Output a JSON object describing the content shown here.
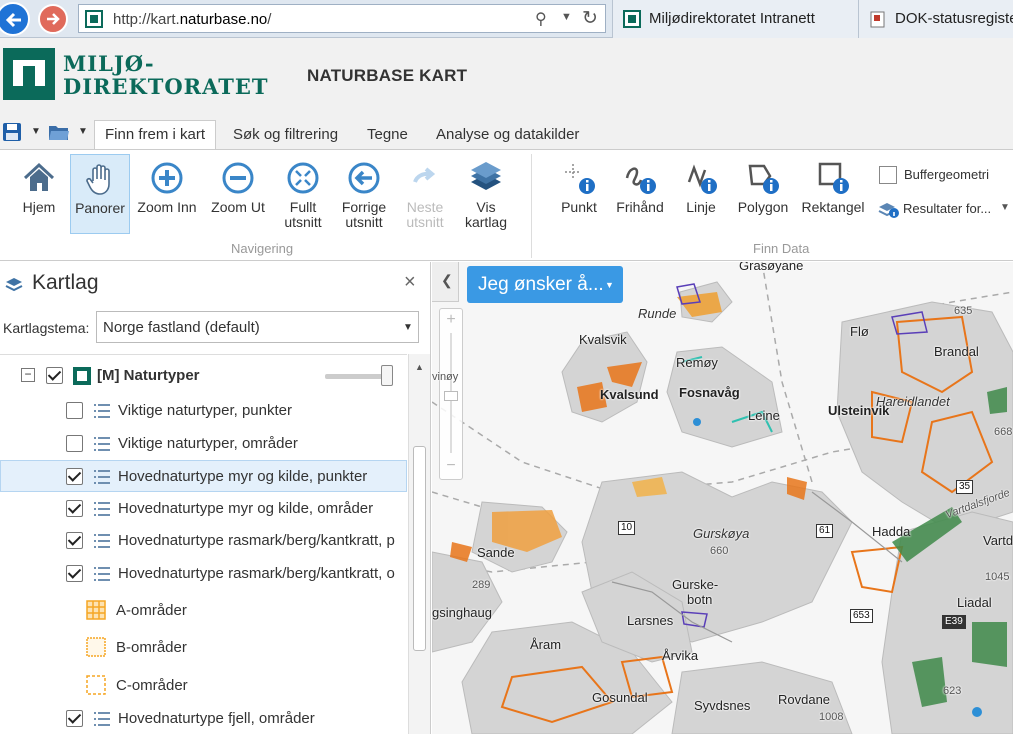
{
  "browser": {
    "url_prefix": "http://kart.",
    "url_domain": "naturbase.no",
    "url_suffix": "/",
    "tabs": [
      {
        "label": "Miljødirektoratet Intranett"
      },
      {
        "label": "DOK-statusregiste"
      }
    ]
  },
  "header": {
    "logo_line1": "MILJØ-",
    "logo_line2": "DIREKTORATET",
    "app_title": "NATURBASE KART"
  },
  "ribbon": {
    "tabs": [
      "Finn frem i kart",
      "Søk og filtrering",
      "Tegne",
      "Analyse og datakilder"
    ],
    "navigation_group": "Navigering",
    "find_data_group": "Finn Data",
    "nav_buttons": {
      "home": "Hjem",
      "pan": "Panorer",
      "zoom_in": "Zoom Inn",
      "zoom_out": "Zoom Ut",
      "full_l1": "Fullt",
      "full_l2": "utsnitt",
      "prev_l1": "Forrige",
      "prev_l2": "utsnitt",
      "next_l1": "Neste",
      "next_l2": "utsnitt",
      "layers_l1": "Vis",
      "layers_l2": "kartlag"
    },
    "data_buttons": {
      "point": "Punkt",
      "freehand": "Frihånd",
      "line": "Linje",
      "polygon": "Polygon",
      "rectangle": "Rektangel"
    },
    "buffer_label": "Buffergeometri",
    "results_label": "Resultater for..."
  },
  "layer_panel": {
    "title": "Kartlag",
    "close": "×",
    "theme_label": "Kartlagstema:",
    "theme_value": "Norge fastland (default)",
    "group": {
      "label": "[M] Naturtyper",
      "collapse": "−"
    },
    "layers": [
      {
        "label": "Viktige naturtyper, punkter",
        "checked": false
      },
      {
        "label": "Viktige naturtyper, områder",
        "checked": false
      },
      {
        "label": "Hovednaturtype myr og kilde, punkter",
        "checked": true
      },
      {
        "label": "Hovednaturtype myr og kilde, områder",
        "checked": true
      },
      {
        "label": "Hovednaturtype rasmark/berg/kantkratt, p",
        "checked": true
      },
      {
        "label": "Hovednaturtype rasmark/berg/kantkratt, o",
        "checked": true
      }
    ],
    "legend": [
      {
        "label": "A-områder",
        "color": "#f5a623"
      },
      {
        "label": "B-områder",
        "color": "#f5a623"
      },
      {
        "label": "C-områder",
        "color": "#f5a623"
      }
    ],
    "last_layer": {
      "label": "Hovednaturtype fjell, områder",
      "checked": true
    }
  },
  "map": {
    "wish_button": "Jeg ønsker å...",
    "zoom_plus": "+",
    "zoom_minus": "−",
    "places": {
      "grasoyane": "Grasøyane",
      "runde": "Runde",
      "kvalsvik": "Kvalsvik",
      "remoy": "Remøy",
      "flo": "Flø",
      "brandal": "Brandal",
      "hareidlandet": "Hareidlandet",
      "kvalsund": "Kvalsund",
      "fosnavag": "Fosnavåg",
      "leine": "Leine",
      "ulsteinvik": "Ulsteinvik",
      "gurskoya": "Gurskøya",
      "sande": "Sande",
      "hadda": "Hadda",
      "vartdalsfjorde": "Vartdalsfjorde",
      "vartd": "Vartd",
      "gurske": "Gurske-",
      "botn": "botn",
      "larsnes": "Larsnes",
      "liadal": "Liadal",
      "gsinghaug": "gsinghaug",
      "aram": "Åram",
      "arvika": "Årvika",
      "gosundal": "Gosundal",
      "syvdsnes": "Syvdsnes",
      "rovdane": "Rovdane",
      "viney": "vinøy"
    },
    "numbers": {
      "n635": "635",
      "n668": "668",
      "n35": "35",
      "n10": "10",
      "n660": "660",
      "n61": "61",
      "n289": "289",
      "n653": "653",
      "n1045": "1045",
      "e39": "E39",
      "n1008": "1008",
      "n623": "623"
    }
  }
}
